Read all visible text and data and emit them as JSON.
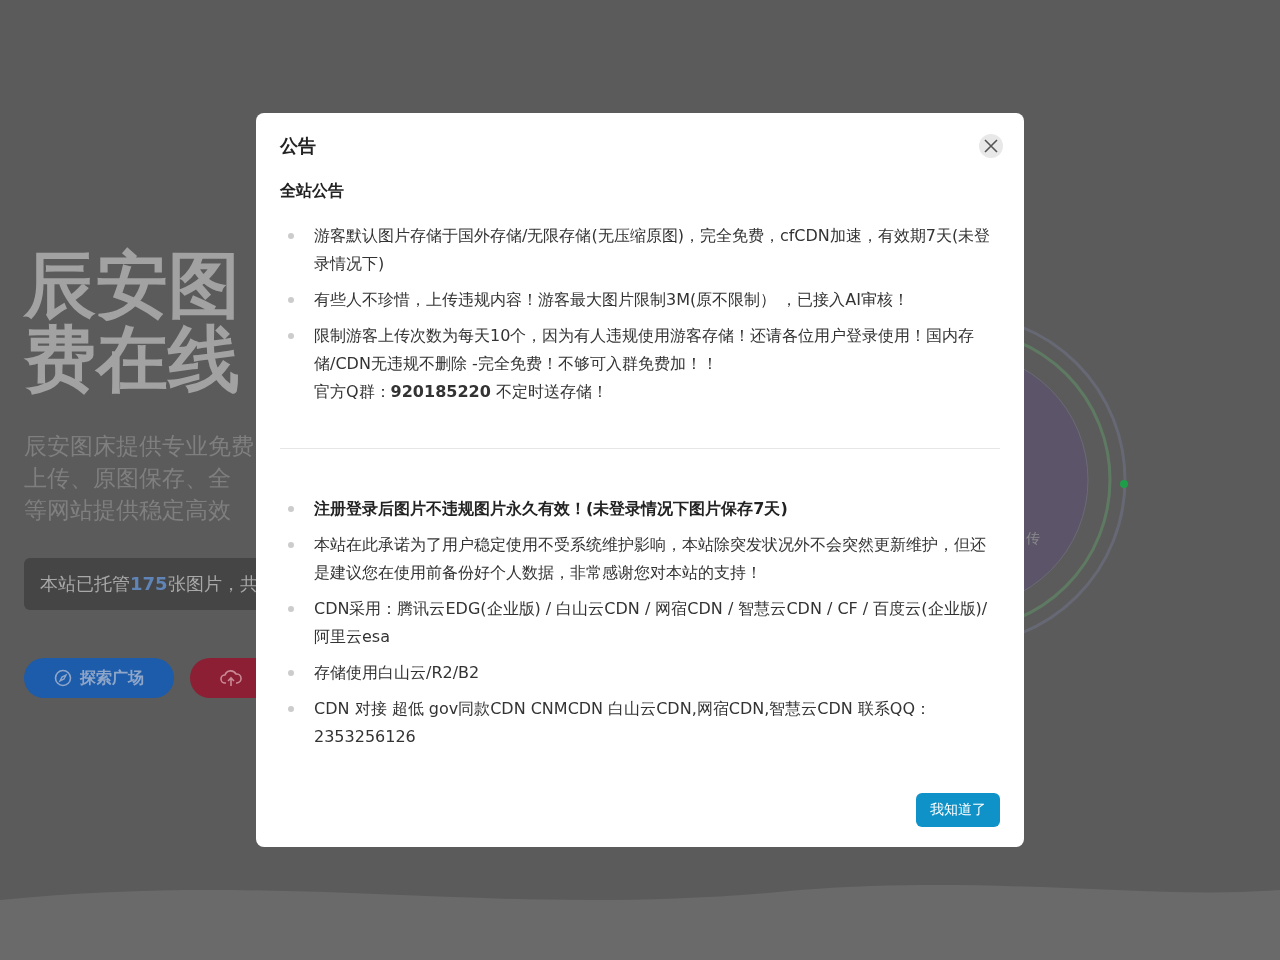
{
  "background": {
    "hero_title_lines": [
      "辰安图",
      "费在线"
    ],
    "description_lines": [
      "辰安图床提供专业免费",
      "上传、原图保存、全",
      "等网站提供稳定高效"
    ],
    "stats_text": "本站已托管**175**张图片，共",
    "buttons": [
      {
        "kind": "explore",
        "label": "探索广场"
      },
      {
        "kind": "upload"
      }
    ],
    "circle_caption": "传"
  },
  "modal": {
    "title": "公告",
    "heading": "全站公告",
    "notices": [
      {
        "bold": false,
        "lines": [
          "游客默认图片存储于国外存储/无限存储(无压缩原图)，完全免费，cfCDN加速，有效期7天(未登录情况下)"
        ]
      },
      {
        "bold": false,
        "lines": [
          "有些人不珍惜，上传违规内容！游客最大图片限制3M(原不限制）  ，已接入AI审核！"
        ]
      },
      {
        "bold": false,
        "lines": [
          "限制游客上传次数为每天10个，因为有人违规使用游客存储！还请各位用户登录使用！国内存储/CDN无违规不删除 -完全免费！不够可入群免费加！！",
          "官方Q群：**920185220** 不定时送存储！"
        ]
      }
    ],
    "notes": [
      {
        "bold": true,
        "lines": [
          "注册登录后图片不违规图片永久有效！(未登录情况下图片保存7天)"
        ]
      },
      {
        "bold": false,
        "lines": [
          "本站在此承诺为了用户稳定使用不受系统维护影响，本站除突发状况外不会突然更新维护，但还是建议您在使用前备份好个人数据，非常感谢您对本站的支持！"
        ]
      },
      {
        "bold": false,
        "lines": [
          "CDN采用：腾讯云EDG(企业版) / 白山云CDN / 网宿CDN / 智慧云CDN / CF / 百度云(企业版)/阿里云esa"
        ]
      },
      {
        "bold": false,
        "lines": [
          "存储使用白山云/R2/B2"
        ]
      },
      {
        "bold": false,
        "lines": [
          "CDN 对接 超低 gov同款CDN CNMCDN 白山云CDN,网宿CDN,智慧云CDN 联系QQ：2353256126"
        ]
      }
    ],
    "confirm_button": "我知道了"
  }
}
